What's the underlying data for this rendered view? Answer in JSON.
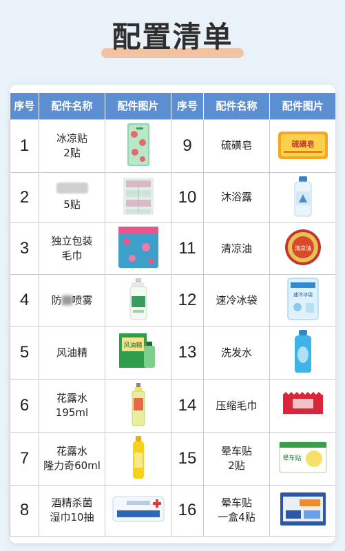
{
  "title": "配置清单",
  "headers": [
    "序号",
    "配件名称",
    "配件图片",
    "序号",
    "配件名称",
    "配件图片"
  ],
  "rows": [
    {
      "left": {
        "no": "1",
        "line1": "冰凉贴",
        "line2": "2贴",
        "icon": "cooling-patch-green-icon"
      },
      "right": {
        "no": "9",
        "line1": "硫磺皂",
        "line2": "",
        "icon": "sulfur-soap-icon"
      }
    },
    {
      "left": {
        "no": "2",
        "line1": "",
        "line2": "5贴",
        "icon": "patch-sheets-icon"
      },
      "right": {
        "no": "10",
        "line1": "沐浴露",
        "line2": "",
        "icon": "body-wash-bottle-icon"
      }
    },
    {
      "left": {
        "no": "3",
        "line1": "独立包装",
        "line2": "毛巾",
        "icon": "packaged-towel-icon"
      },
      "right": {
        "no": "11",
        "line1": "清凉油",
        "line2": "",
        "icon": "cooling-balm-tin-icon"
      }
    },
    {
      "left": {
        "no": "4",
        "line1": "防",
        "line1b": "喷雾",
        "line2": "",
        "icon": "spray-bottle-icon"
      },
      "right": {
        "no": "12",
        "line1": "速冷冰袋",
        "line2": "",
        "icon": "ice-pack-icon"
      }
    },
    {
      "left": {
        "no": "5",
        "line1": "风油精",
        "line2": "",
        "icon": "essential-oil-box-icon"
      },
      "right": {
        "no": "13",
        "line1": "洗发水",
        "line2": "",
        "icon": "shampoo-bottle-icon"
      }
    },
    {
      "left": {
        "no": "6",
        "line1": "花露水",
        "line2": "195ml",
        "icon": "florida-water-bottle-icon"
      },
      "right": {
        "no": "14",
        "line1": "压缩毛巾",
        "line2": "",
        "icon": "compressed-towel-icon"
      }
    },
    {
      "left": {
        "no": "7",
        "line1": "花露水",
        "line2": "隆力奇60ml",
        "icon": "florida-water-small-icon"
      },
      "right": {
        "no": "15",
        "line1": "晕车贴",
        "line2": "2贴",
        "icon": "motion-sickness-patch-icon"
      }
    },
    {
      "left": {
        "no": "8",
        "line1": "酒精杀菌",
        "line2": "湿巾10抽",
        "icon": "alcohol-wipes-icon"
      },
      "right": {
        "no": "16",
        "line1": "晕车贴",
        "line2": "一盒4贴",
        "icon": "motion-patch-box-icon"
      }
    }
  ],
  "product_labels": {
    "soap_label": "硫磺皂",
    "ice_pack_label": "速冷冰袋",
    "balm_label": "清凉油",
    "oil_label": "风油精",
    "patch_label": "晕车贴"
  }
}
